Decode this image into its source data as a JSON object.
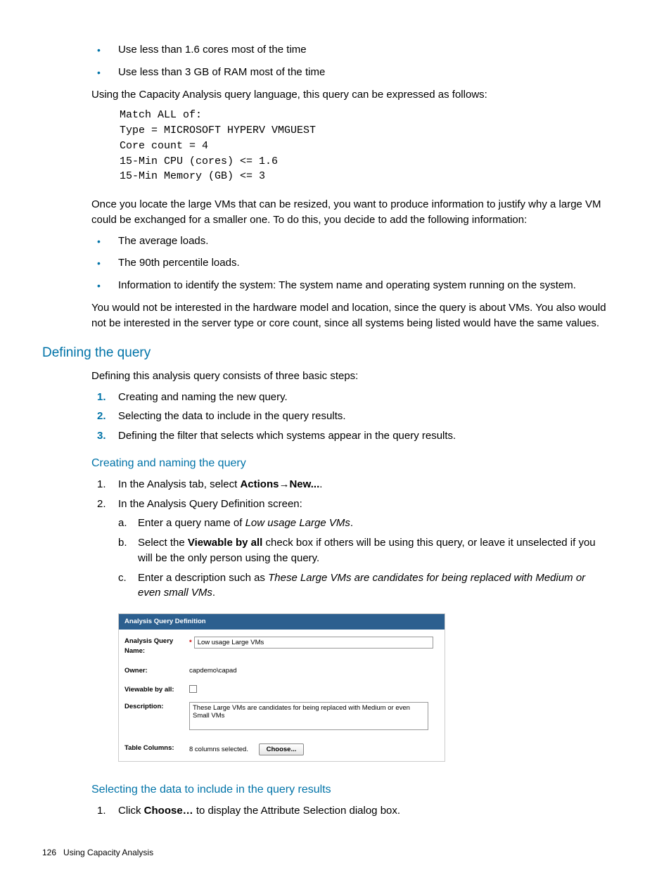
{
  "intro_bullets": [
    "Use less than 1.6 cores most of the time",
    "Use less than 3 GB of RAM most of the time"
  ],
  "intro_para": "Using the Capacity Analysis query language, this query can be expressed as follows:",
  "code": "Match ALL of:\nType = MICROSOFT HYPERV VMGUEST\nCore count = 4\n15-Min CPU (cores) <= 1.6\n15-Min Memory (GB) <= 3",
  "para2": "Once you locate the large VMs that can be resized, you want to produce information to justify why a large VM could be exchanged for a smaller one. To do this, you decide to add the following information:",
  "info_bullets": [
    "The average loads.",
    "The 90th percentile loads.",
    "Information to identify the system: The system name and operating system running on the system."
  ],
  "para3": "You would not be interested in the hardware model and location, since the query is about VMs. You also would not be interested in the server type or core count, since all systems being listed would have the same values.",
  "heading_define": "Defining the query",
  "define_intro": "Defining this analysis query consists of three basic steps:",
  "define_steps": [
    "Creating and naming the new query.",
    "Selecting the data to include in the query results.",
    "Defining the filter that selects which systems appear in the query results."
  ],
  "heading_creating": "Creating and naming the query",
  "creating_step1_pre": "In the Analysis tab, select ",
  "creating_step1_bold1": "Actions",
  "creating_step1_arrow": "→",
  "creating_step1_bold2": "New...",
  "creating_step1_post": ".",
  "creating_step2": "In the Analysis Query Definition screen:",
  "creating_sub": {
    "a_pre": "Enter a query name of ",
    "a_italic": "Low usage Large VMs",
    "a_post": ".",
    "b_pre": "Select the ",
    "b_bold": "Viewable by all",
    "b_post": " check box if others will be using this query, or leave it unselected if you will be the only person using the query.",
    "c_pre": "Enter a description such as ",
    "c_italic": "These Large VMs are candidates for being replaced with Medium or even small VMs",
    "c_post": "."
  },
  "figure": {
    "title": "Analysis Query Definition",
    "name_label": "Analysis Query Name:",
    "name_value": "Low usage Large VMs",
    "owner_label": "Owner:",
    "owner_value": "capdemo\\capad",
    "viewable_label": "Viewable by all:",
    "desc_label": "Description:",
    "desc_value": "These Large VMs are candidates for being replaced with Medium or even Small VMs",
    "columns_label": "Table Columns:",
    "columns_status": "8 columns selected.",
    "choose_btn": "Choose..."
  },
  "heading_selecting": "Selecting the data to include in the query results",
  "selecting_step1_pre": "Click ",
  "selecting_step1_bold": "Choose…",
  "selecting_step1_post": " to display the Attribute Selection dialog box.",
  "footer": {
    "page": "126",
    "title": "Using Capacity Analysis"
  }
}
